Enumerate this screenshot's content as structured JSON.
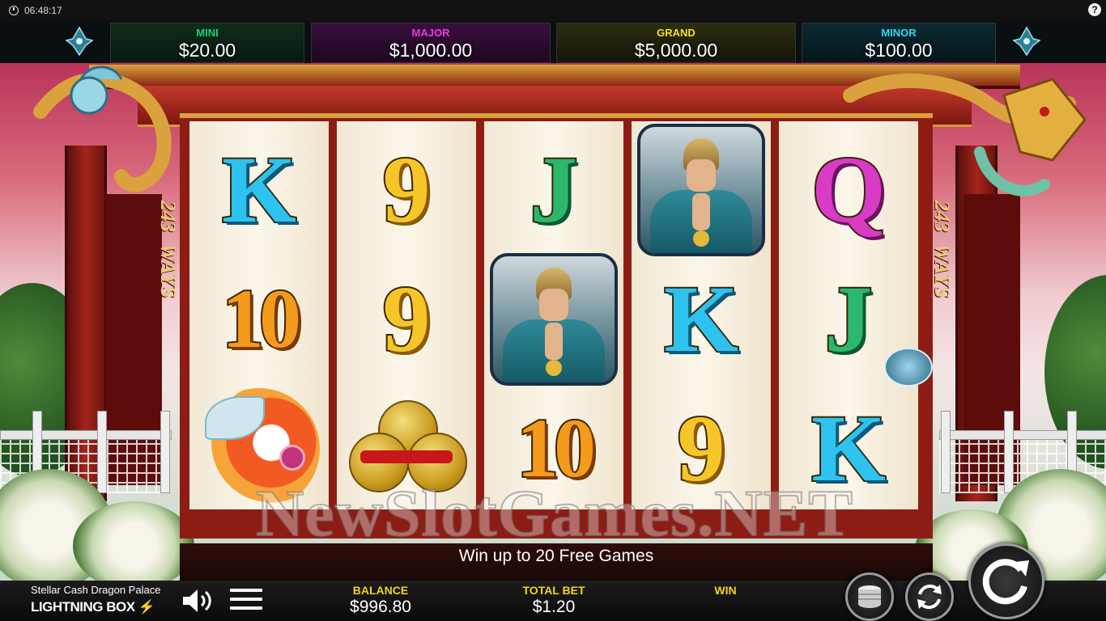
{
  "status": {
    "time": "06:48:17",
    "help_label": "?"
  },
  "jackpots": [
    {
      "label": "MINI",
      "value": "$20.00",
      "color": "#1fd46b"
    },
    {
      "label": "MAJOR",
      "value": "$1,000.00",
      "color": "#e83be0"
    },
    {
      "label": "GRAND",
      "value": "$5,000.00",
      "color": "#f2e31a"
    },
    {
      "label": "MINOR",
      "value": "$100.00",
      "color": "#3bd3ee"
    }
  ],
  "ways": {
    "number": "243",
    "word": "WAYS"
  },
  "reels": [
    [
      "K",
      "10",
      "koi"
    ],
    [
      "9",
      "9",
      "coins"
    ],
    [
      "J",
      "warrior",
      "10"
    ],
    [
      "warrior",
      "K",
      "9"
    ],
    [
      "Q",
      "J",
      "K"
    ]
  ],
  "symbol_names": {
    "koi": "koi-fish-icon",
    "coins": "gold-coins-icon",
    "warrior": "warrior-icon"
  },
  "watermark": "NewSlotGames.NET",
  "promo": "Win up to 20 Free Games",
  "footer": {
    "game_name": "Stellar Cash Dragon Palace",
    "brand_text": "LIGHTNING BOX",
    "balance_label": "BALANCE",
    "balance_value": "$996.80",
    "bet_label": "TOTAL BET",
    "bet_value": "$1.20",
    "win_label": "WIN",
    "win_value": ""
  },
  "icons": [
    "clock-icon",
    "help-icon",
    "ship-icon",
    "sound-icon",
    "menu-icon",
    "coin-stack-icon",
    "autoplay-icon",
    "spin-icon"
  ]
}
